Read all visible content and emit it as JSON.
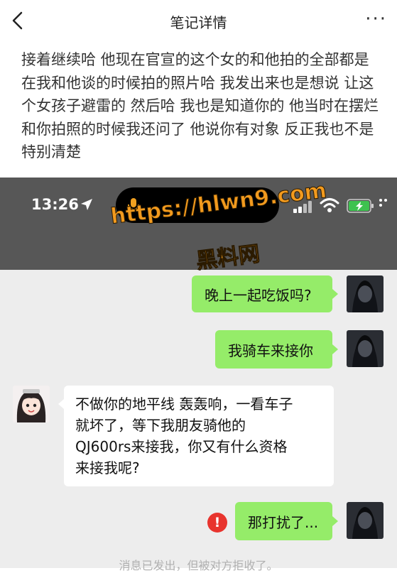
{
  "header": {
    "title": "笔记详情",
    "more": "···"
  },
  "post": {
    "text": "接着继续哈 他现在官宣的这个女的和他拍的全部都是在我和他谈的时候拍的照片哈 我发出来也是想说 让这个女孩子避雷的 然后哈 我也是知道你的 他当时在摆烂和你拍照的时候我还问了 他说你有对象 反正我也不是特别清楚"
  },
  "screenshot": {
    "status_bar": {
      "time": "13:26"
    },
    "watermark": {
      "url": "https://hlwn9.com",
      "cn": "黑料网"
    },
    "messages": [
      {
        "side": "right",
        "text": "晚上一起吃饭吗?"
      },
      {
        "side": "right",
        "text": "我骑车来接你"
      },
      {
        "side": "left",
        "lines": [
          "不做你的地平线 轰轰响，一看车子",
          "就坏了，等下我朋友骑他的",
          "QJ600rs来接我，你又有什么资格",
          "来接我呢?"
        ]
      },
      {
        "side": "right",
        "text": "那打扰了...",
        "failed": true,
        "error_mark": "!"
      }
    ],
    "notice": "消息已发出，但被对方拒收了。"
  },
  "colors": {
    "bubble_green": "#95ec69",
    "status_gray": "#575757",
    "chat_bg": "#ededed",
    "watermark": "#f29a1e",
    "error_red": "#e8342e"
  }
}
